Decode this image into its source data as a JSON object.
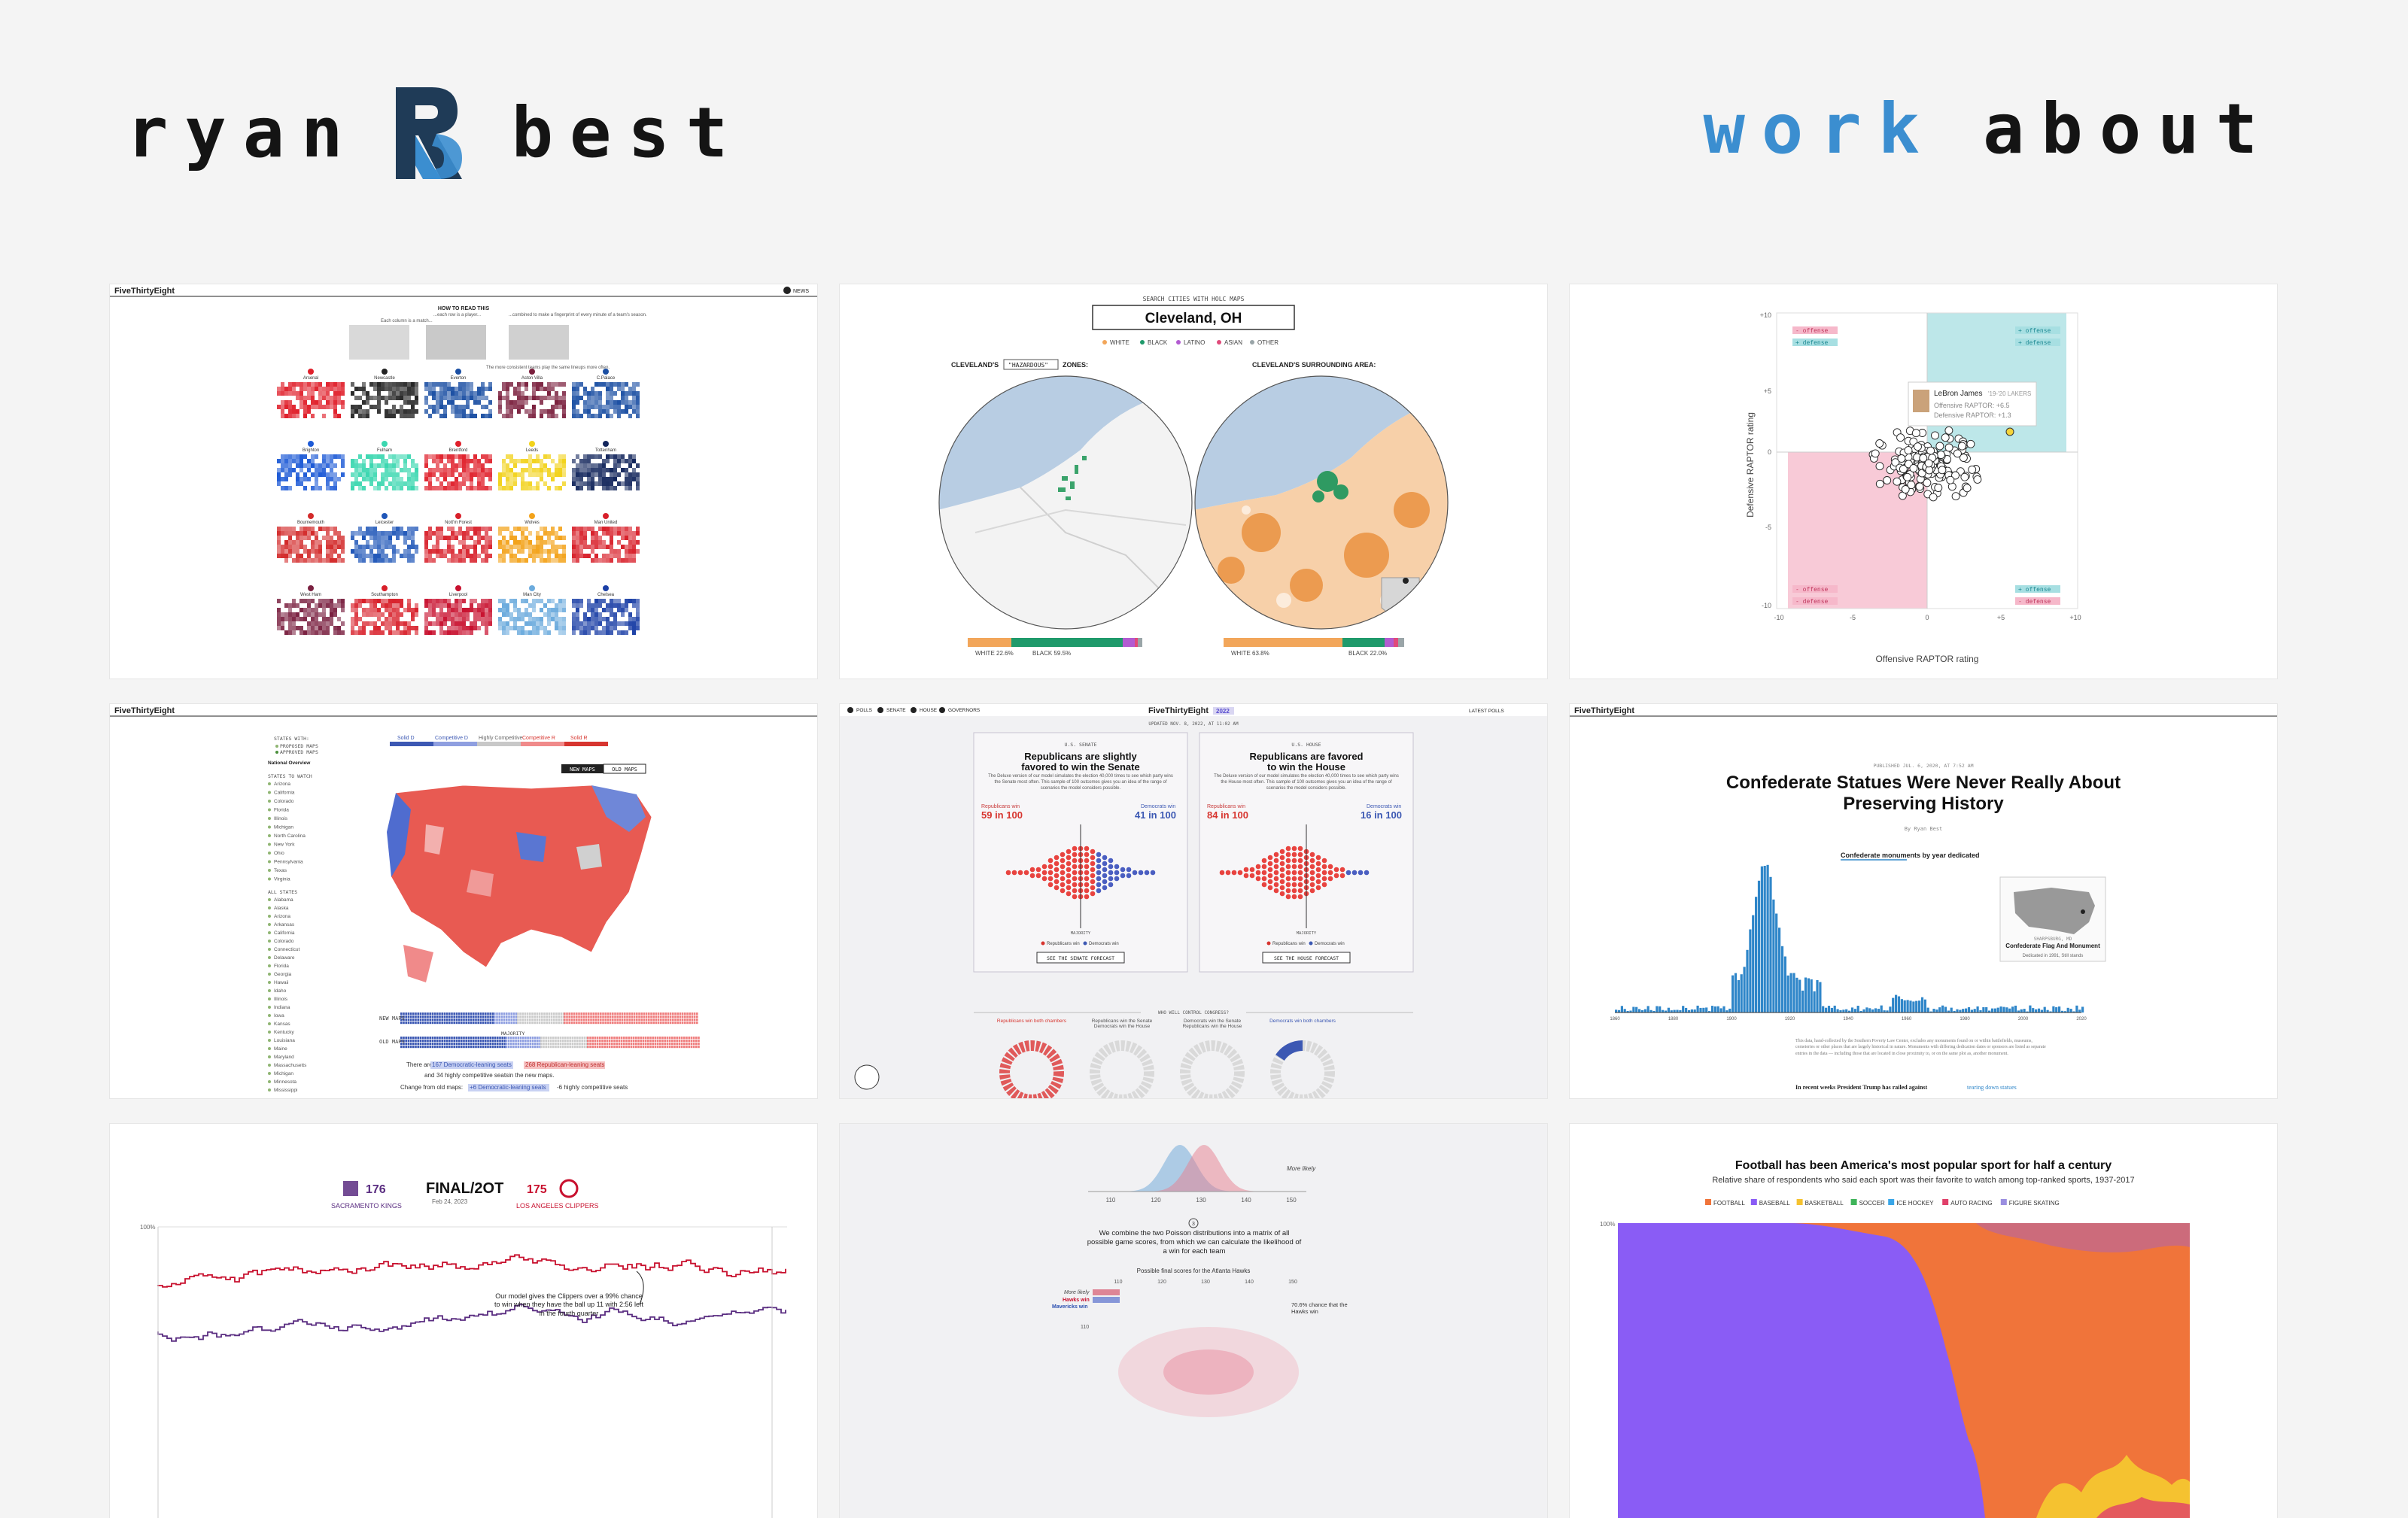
{
  "site": {
    "logo_first": "ryan",
    "logo_last": "best",
    "nav": {
      "work": "work",
      "about": "about"
    }
  },
  "brand": {
    "accent": "#3b8ed0",
    "text": "#141414",
    "background": "#f4f4f4"
  },
  "cards": {
    "c1": {
      "masthead": "FiveThirtyEight",
      "network": "NEWS",
      "heading": "HOW TO READ THIS",
      "note_1": "Each column is a match...",
      "note_2": "...each row is a player...",
      "note_3": "...combined to make a fingerprint of every minute of a team's season.",
      "note_4": "The more consistent teams play the same lineups more often.",
      "teams": [
        "Arsenal",
        "Newcastle",
        "Everton",
        "Aston Villa",
        "C.Palace",
        "Brighton",
        "Fulham",
        "Brentford",
        "Leeds",
        "Tottenham",
        "Bournemouth",
        "Leicester",
        "Nott'm Forest",
        "Wolves",
        "Man United",
        "West Ham",
        "Southampton",
        "Liverpool",
        "Man City",
        "Chelsea"
      ]
    },
    "c2": {
      "search_label": "SEARCH CITIES WITH HOLC MAPS",
      "city": "Cleveland, OH",
      "legend": [
        "WHITE",
        "BLACK",
        "LATINO",
        "ASIAN",
        "OTHER"
      ],
      "left_title_pre": "CLEVELAND'S",
      "left_select": "\"HAZARDOUS\"",
      "left_title_post": "ZONES:",
      "right_title": "CLEVELAND'S SURROUNDING AREA:",
      "left_white": "WHITE 22.6%",
      "left_black": "BLACK 59.5%",
      "right_white": "WHITE 63.8%",
      "right_black": "BLACK 22.0%"
    },
    "c3": {
      "quad_tl": [
        "- offense",
        "+ defense"
      ],
      "quad_tr": [
        "+ offense",
        "+ defense"
      ],
      "quad_bl": [
        "- offense",
        "- defense"
      ],
      "quad_br": [
        "+ offense",
        "- defense"
      ],
      "tooltip_name": "LeBron James",
      "tooltip_team": "'19-'20 LAKERS",
      "tooltip_off": "Offensive RAPTOR: +6.5",
      "tooltip_def": "Defensive RAPTOR: +1.3",
      "xlabel": "Offensive RAPTOR rating",
      "ylabel": "Defensive RAPTOR rating",
      "xticks": [
        "-10",
        "-5",
        "0",
        "+5",
        "+10"
      ],
      "yticks": [
        "+10",
        "+5",
        "0",
        "-5",
        "-10"
      ]
    },
    "c4": {
      "masthead": "FiveThirtyEight",
      "states_with": "STATES WITH:",
      "proposed": "PROPOSED MAPS",
      "approved": "APPROVED MAPS",
      "overview": "National Overview",
      "states_to_watch": "STATES TO WATCH",
      "watch_states": [
        "Arizona",
        "California",
        "Colorado",
        "Florida",
        "Illinois",
        "Michigan",
        "North Carolina",
        "New York",
        "Ohio",
        "Pennsylvania",
        "Texas",
        "Virginia"
      ],
      "all_states": "ALL STATES",
      "all_state_list": [
        "Alabama",
        "Alaska",
        "Arizona",
        "Arkansas",
        "California",
        "Colorado",
        "Connecticut",
        "Delaware",
        "Florida",
        "Georgia",
        "Hawaii",
        "Idaho",
        "Illinois",
        "Indiana",
        "Iowa",
        "Kansas",
        "Kentucky",
        "Louisiana",
        "Maine",
        "Maryland",
        "Massachusetts",
        "Michigan",
        "Minnesota",
        "Mississippi"
      ],
      "legend": [
        "Solid D",
        "Competitive D",
        "Highly Competitive",
        "Competitive R",
        "Solid R"
      ],
      "btn_new": "NEW MAPS",
      "btn_old": "OLD MAPS",
      "new_maps": "NEW MAPS",
      "old_maps": "OLD MAPS",
      "majority": "MAJORITY",
      "summary_1a": "There are",
      "summary_1b": "167 Democratic-leaning seats",
      "summary_1c": "268 Republican-leaning seats",
      "summary_2a": "and",
      "summary_2b": "34 highly competitive seats",
      "summary_2c": "in the new maps.",
      "change_a": "Change from old maps:",
      "change_b": "+6 Democratic-leaning seats",
      "change_c": "-6 highly competitive seats"
    },
    "c5": {
      "nav": [
        "POLLS",
        "SENATE",
        "HOUSE",
        "GOVERNORS"
      ],
      "masthead": "FiveThirtyEight",
      "year": "2022",
      "latest": "LATEST POLLS",
      "updated": "UPDATED NOV. 8, 2022, AT 11:02 AM",
      "senate_label": "U.S. SENATE",
      "senate_head_1": "Republicans are slightly",
      "senate_head_2": "favored to win the Senate",
      "senate_desc": "The Deluxe version of our model simulates the election 40,000 times to see which party wins the Senate most often. This sample of 100 outcomes gives you an idea of the range of scenarios the model considers possible.",
      "senate_r_label": "Republicans win",
      "senate_r": "59 in 100",
      "senate_d_label": "Democrats win",
      "senate_d": "41 in 100",
      "senate_btn": "SEE THE SENATE FORECAST",
      "house_label": "U.S. HOUSE",
      "house_head_1": "Republicans are favored",
      "house_head_2": "to win the House",
      "house_desc": "The Deluxe version of our model simulates the election 40,000 times to see which party wins the House most often. This sample of 100 outcomes gives you an idea of the range of scenarios the model considers possible.",
      "house_r_label": "Republicans win",
      "house_r": "84 in 100",
      "house_d_label": "Democrats win",
      "house_d": "16 in 100",
      "house_btn": "SEE THE HOUSE FORECAST",
      "majority": "MAJORITY",
      "key_r": "Republicans win",
      "key_d": "Democrats win",
      "control": "WHO WILL CONTROL CONGRESS?",
      "scenarios": [
        "Republicans win both chambers",
        "Republicans win the Senate Democrats win the House",
        "Democrats win the Senate Republicans win the House",
        "Democrats win both chambers"
      ]
    },
    "c6": {
      "masthead": "FiveThirtyEight",
      "published": "PUBLISHED JUL. 6, 2020, AT 7:52 AM",
      "title_1": "Confederate Statues Were Never Really About",
      "title_2": "Preserving History",
      "byline": "By Ryan Best",
      "chart_title": "Confederate monuments by year dedicated",
      "tooltip_loc": "SHARPSBURG, MD",
      "tooltip_name": "Confederate Flag And Monument",
      "tooltip_year": "Dedicated in 1991, Still stands",
      "xticks": [
        "1860",
        "1880",
        "1900",
        "1920",
        "1940",
        "1960",
        "1980",
        "2000",
        "2020"
      ],
      "body": "This data, hand-collected by the Southern Poverty Law Center, excludes any monuments found on or within battlefields, museums, cemeteries or other places that are largely historical in nature. Monuments with differing dedication dates or sponsors are listed as separate entries in the data — including those that are located in close proximity to, or on the same plot as, another monument.",
      "lede_a": "In recent weeks President Trump has railed against",
      "lede_b": "tearing down statues",
      "chart_data": {
        "type": "bar",
        "title": "Confederate monuments by year dedicated",
        "x": [
          1860,
          1870,
          1880,
          1890,
          1900,
          1905,
          1908,
          1910,
          1911,
          1912,
          1913,
          1914,
          1915,
          1920,
          1925,
          1930,
          1940,
          1950,
          1960,
          1970,
          1980,
          1990,
          2000,
          2010,
          2020
        ],
        "values": [
          1,
          2,
          4,
          9,
          22,
          38,
          60,
          85,
          120,
          95,
          70,
          50,
          30,
          20,
          14,
          10,
          6,
          4,
          10,
          3,
          4,
          6,
          4,
          3,
          2
        ],
        "xlim": [
          1860,
          2020
        ]
      }
    },
    "c7": {
      "away_team": "SACRAMENTO KINGS",
      "away_score": "176",
      "status": "FINAL/2OT",
      "date": "Feb 24, 2023",
      "home_team": "LOS ANGELES CLIPPERS",
      "home_score": "175",
      "y_label": "100%",
      "annotation": "Our model gives the Clippers over a 99% chance to win when they have the ball up 11 with 2:56 left in the fourth quarter"
    },
    "c8": {
      "x_ticks": [
        "110",
        "120",
        "130",
        "140",
        "150"
      ],
      "more_likely": "More likely",
      "step": "3",
      "text": "We combine the two Poisson distributions into a matrix of all possible game scores, from which we can calculate the likelihood of a win for each team",
      "scores_label": "Possible final scores for the Atlanta Hawks",
      "grid_ticks": [
        "110",
        "120",
        "130",
        "140",
        "150"
      ],
      "legend_more": "More likely",
      "hawks": "Hawks win",
      "mavs": "Mavericks win",
      "row_label": "110",
      "note": "70.6% chance that the Hawks win"
    },
    "c9": {
      "title": "Football has been America's most popular sport for half a century",
      "subtitle": "Relative share of respondents who said each sport was their favorite to watch among top-ranked sports, 1937-2017",
      "legend": [
        "FOOTBALL",
        "BASEBALL",
        "BASKETBALL",
        "SOCCER",
        "ICE HOCKEY",
        "AUTO RACING",
        "FIGURE SKATING"
      ],
      "legend_colors": [
        "#f0743a",
        "#8a5cf5",
        "#f5c230",
        "#3fb45a",
        "#3aa6e8",
        "#e0406a",
        "#9b8fe0"
      ],
      "y_label": "100%"
    }
  }
}
